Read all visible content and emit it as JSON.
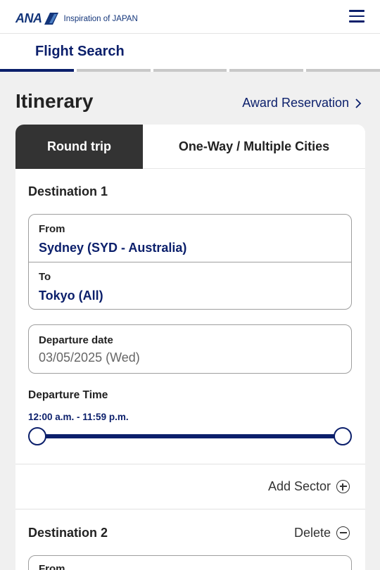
{
  "header": {
    "logo_text": "ANA",
    "tagline": "Inspiration of JAPAN",
    "menu_icon": "hamburger-menu-icon"
  },
  "step": {
    "title": "Flight Search",
    "progress_total": 5,
    "progress_current": 1
  },
  "itinerary": {
    "heading": "Itinerary",
    "award_link": "Award Reservation",
    "tabs": [
      {
        "label": "Round trip",
        "active": true
      },
      {
        "label": "One-Way / Multiple Cities",
        "active": false
      }
    ]
  },
  "destination1": {
    "title": "Destination 1",
    "from_label": "From",
    "from_value": "Sydney (SYD - Australia)",
    "to_label": "To",
    "to_value": "Tokyo (All)",
    "date_label": "Departure date",
    "date_value": "03/05/2025 (Wed)",
    "time_label": "Departure Time",
    "time_range": "12:00 a.m. - 11:59 p.m."
  },
  "add_sector": "Add Sector",
  "destination2": {
    "title": "Destination 2",
    "delete_label": "Delete",
    "from_label": "From"
  },
  "colors": {
    "brand_navy": "#0b1f6b",
    "tab_active_bg": "#333333",
    "page_bg": "#f0f0f0"
  }
}
